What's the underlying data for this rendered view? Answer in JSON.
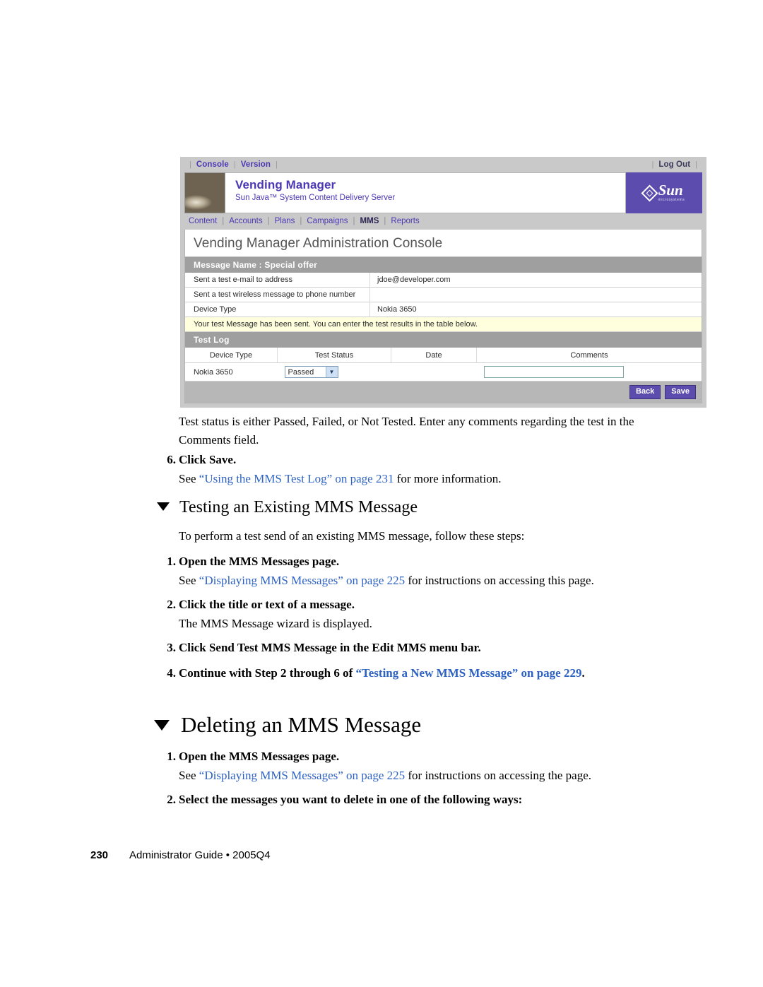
{
  "screenshot": {
    "topbar": {
      "console_label": "Console",
      "version_label": "Version",
      "logout_label": "Log Out"
    },
    "banner": {
      "title": "Vending Manager",
      "subtitle": "Sun Java™ System Content Delivery Server",
      "logo_word": "Sun",
      "logo_micro": "microsystems"
    },
    "nav": [
      {
        "label": "Content",
        "active": false
      },
      {
        "label": "Accounts",
        "active": false
      },
      {
        "label": "Plans",
        "active": false
      },
      {
        "label": "Campaigns",
        "active": false
      },
      {
        "label": "MMS",
        "active": true
      },
      {
        "label": "Reports",
        "active": false
      }
    ],
    "console_title": "Vending Manager Administration Console",
    "message_band": "Message Name : Special offer",
    "info_rows": [
      {
        "label": "Sent a test e-mail to address",
        "value": "jdoe@developer.com"
      },
      {
        "label": "Sent a test wireless message to phone number",
        "value": ""
      },
      {
        "label": "Device Type",
        "value": "Nokia 3650"
      }
    ],
    "notice": "Your test Message has been sent. You can enter the test results in the table below.",
    "test_log_band": "Test Log",
    "log_columns": [
      "Device Type",
      "Test Status",
      "Date",
      "Comments"
    ],
    "log_rows": [
      {
        "device_type": "Nokia 3650",
        "test_status": "Passed",
        "date": "",
        "comments": ""
      }
    ],
    "buttons": {
      "back": "Back",
      "save": "Save"
    },
    "colors": {
      "chrome": "#c9c9c9",
      "accent_purple": "#5b4cad",
      "link_purple": "#4b38b3",
      "band_gray": "#9f9f9f",
      "notice_yellow": "#ffffdd"
    }
  },
  "document": {
    "intro_paragraph": "Test status is either Passed, Failed, or Not Tested. Enter any comments regarding the test in the Comments field.",
    "step6": {
      "num": "6.",
      "text": "Click Save."
    },
    "step6_see": {
      "prefix": "See ",
      "link": "“Using the MMS Test Log” on page 231",
      "suffix": " for more information."
    },
    "heading_testing": "Testing an Existing MMS Message",
    "testing_intro": "To perform a test send of an existing MMS message, follow these steps:",
    "testing_step1": {
      "num": "1.",
      "text": "Open the MMS Messages page."
    },
    "testing_step1_see": {
      "prefix": "See ",
      "link": "“Displaying MMS Messages” on page 225",
      "suffix": " for instructions on accessing this page."
    },
    "testing_step2": {
      "num": "2.",
      "text": "Click the title or text of a message."
    },
    "testing_step2_note": "The MMS Message wizard is displayed.",
    "testing_step3": {
      "num": "3.",
      "text": "Click Send Test MMS Message in the Edit MMS menu bar."
    },
    "testing_step4": {
      "num": "4.",
      "prefix": "Continue with Step 2 through 6 of ",
      "link": "“Testing a New MMS Message” on page 229",
      "suffix": "."
    },
    "heading_deleting": "Deleting an MMS Message",
    "deleting_step1": {
      "num": "1.",
      "text": "Open the MMS Messages page."
    },
    "deleting_step1_see": {
      "prefix": "See ",
      "link": "“Displaying MMS Messages” on page 225",
      "suffix": " for instructions on accessing the page."
    },
    "deleting_step2": {
      "num": "2.",
      "text": "Select the messages you want to delete in one of the following ways:"
    },
    "footer": {
      "page_number": "230",
      "text": "Administrator Guide • 2005Q4"
    }
  }
}
